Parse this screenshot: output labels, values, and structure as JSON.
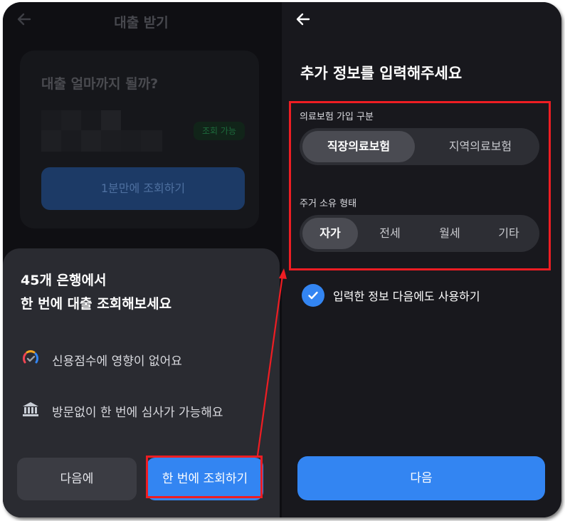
{
  "left": {
    "header_title": "대출 받기",
    "card_question": "대출 얼마까지 될까?",
    "badge": "조회 가능",
    "card_button": "1분만에 조회하기",
    "sheet": {
      "title_line1": "45개 은행에서",
      "title_line2": "한 번에 대출 조회해보세요",
      "features": [
        {
          "icon": "credit-gauge-icon",
          "text": "신용점수에 영향이 없어요"
        },
        {
          "icon": "bank-icon",
          "text": "방문없이 한 번에 심사가 가능해요"
        }
      ],
      "later_button": "다음에",
      "query_button": "한 번에 조회하기"
    }
  },
  "right": {
    "title": "추가 정보를 입력해주세요",
    "insurance": {
      "label": "의료보험 가입 구분",
      "options": [
        "직장의료보험",
        "지역의료보험"
      ],
      "selected": "직장의료보험"
    },
    "housing": {
      "label": "주거 소유 형태",
      "options": [
        "자가",
        "전세",
        "월세",
        "기타"
      ],
      "selected": "자가"
    },
    "remember": {
      "label": "입력한 정보 다음에도 사용하기",
      "checked": true
    },
    "next_button": "다음"
  },
  "colors": {
    "accent": "#3385f2",
    "highlight": "#ee1d23",
    "background": "#18181d",
    "sheet": "#2a2b31"
  }
}
